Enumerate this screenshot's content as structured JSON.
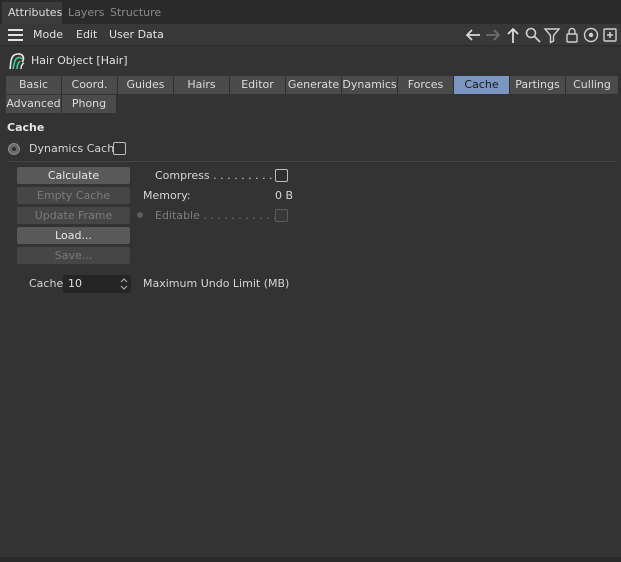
{
  "panel_tabs": [
    {
      "label": "Attributes",
      "active": true
    },
    {
      "label": "Layers",
      "active": false
    },
    {
      "label": "Structure",
      "active": false
    }
  ],
  "menu": {
    "items": [
      "Mode",
      "Edit",
      "User Data"
    ],
    "toolbar_icons": [
      "arrow-left-icon",
      "arrow-right-icon",
      "arrow-up-icon",
      "search-icon",
      "filter-icon",
      "lock-icon",
      "target-icon",
      "add-panel-icon"
    ]
  },
  "object": {
    "title": "Hair Object [Hair]",
    "icon": "hair-object-icon",
    "icon_color": "#3dcf8e"
  },
  "tabs": {
    "row1": [
      "Basic",
      "Coord.",
      "Guides",
      "Hairs",
      "Editor",
      "Generate",
      "Dynamics",
      "Forces",
      "Cache",
      "Partings",
      "Culling"
    ],
    "row2": [
      "Advanced",
      "Phong"
    ],
    "active": "Cache",
    "active_color": "#7b97c1"
  },
  "cache_section": {
    "title": "Cache",
    "dynamics_cache_label": "Dynamics Cache",
    "dynamics_cache_checked": false,
    "buttons": {
      "calculate": "Calculate",
      "empty_cache": "Empty Cache",
      "update_frame": "Update Frame",
      "load": "Load...",
      "save": "Save..."
    },
    "compress_label": "Compress . . . . . . . . . .",
    "compress_checked": false,
    "memory_label": "Memory:",
    "memory_value": "0 B",
    "editable_label": "Editable . . . . . . . . . . .",
    "editable_checked": false,
    "cache_field_label": "Cache",
    "cache_field_value": "10",
    "undo_limit_label": "Maximum Undo Limit (MB)"
  }
}
